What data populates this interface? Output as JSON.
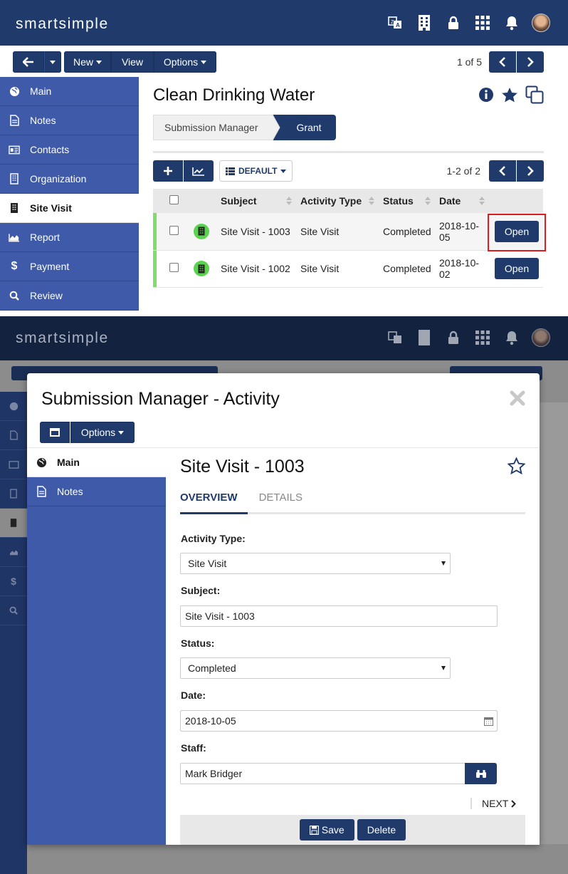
{
  "app": {
    "logo": "smartsimple"
  },
  "toolbar": {
    "new_label": "New",
    "view_label": "View",
    "options_label": "Options"
  },
  "pager": {
    "text": "1 of 5"
  },
  "nav": {
    "items": [
      {
        "label": "Main",
        "icon": "globe-icon"
      },
      {
        "label": "Notes",
        "icon": "document-icon"
      },
      {
        "label": "Contacts",
        "icon": "id-card-icon"
      },
      {
        "label": "Organization",
        "icon": "building-icon"
      },
      {
        "label": "Site Visit",
        "icon": "building-icon",
        "active": true
      },
      {
        "label": "Report",
        "icon": "area-chart-icon"
      },
      {
        "label": "Payment",
        "icon": "dollar-icon"
      },
      {
        "label": "Review",
        "icon": "search-icon"
      }
    ]
  },
  "main": {
    "title": "Clean Drinking Water",
    "breadcrumb": [
      "Submission Manager",
      "Grant"
    ],
    "view_label": "DEFAULT",
    "list_pager": "1-2 of 2",
    "columns": [
      "Subject",
      "Activity Type",
      "Status",
      "Date"
    ],
    "rows": [
      {
        "subject": "Site Visit - 1003",
        "type": "Site Visit",
        "status": "Completed",
        "date": "2018-10-05",
        "action": "Open"
      },
      {
        "subject": "Site Visit - 1002",
        "type": "Site Visit",
        "status": "Completed",
        "date": "2018-10-02",
        "action": "Open"
      }
    ]
  },
  "modal": {
    "title": "Submission Manager - Activity",
    "options_label": "Options",
    "nav": [
      {
        "label": "Main",
        "icon": "globe-icon",
        "active": true
      },
      {
        "label": "Notes",
        "icon": "document-icon"
      }
    ],
    "record_title": "Site Visit - 1003",
    "tabs": [
      "OVERVIEW",
      "DETAILS"
    ],
    "fields": {
      "activity_type": {
        "label": "Activity Type:",
        "value": "Site Visit"
      },
      "subject": {
        "label": "Subject:",
        "value": "Site Visit - 1003"
      },
      "status": {
        "label": "Status:",
        "value": "Completed"
      },
      "date": {
        "label": "Date:",
        "value": "2018-10-05"
      },
      "staff": {
        "label": "Staff:",
        "value": "Mark Bridger"
      }
    },
    "next_label": "NEXT",
    "save_label": "Save",
    "delete_label": "Delete"
  },
  "colors": {
    "header": "#1f3a6b",
    "nav": "#3e5aa8",
    "accent_green": "#7fdd6a",
    "highlight_red": "#e01b1b"
  }
}
